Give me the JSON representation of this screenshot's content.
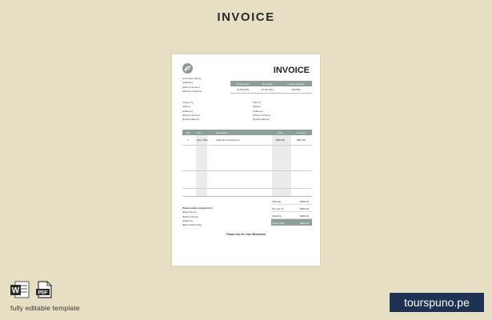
{
  "page_heading": "INVOICE",
  "invoice": {
    "title": "INVOICE",
    "company_lines": [
      "[Company Name]",
      "[Address]",
      "[Phone Number]",
      "[Website Address]"
    ],
    "meta": {
      "headers": [
        "Invoice Date",
        "Due Date",
        "Invoice Number"
      ],
      "values": [
        "31-05-1970",
        "25-04-1971",
        "1437864"
      ]
    },
    "bill_to": {
      "label": "Invoice To:",
      "lines": [
        "[Name]",
        "[Address]",
        "[Phone Number]",
        "[Email Address]"
      ]
    },
    "ship_to": {
      "label": "Ship To:",
      "lines": [
        "[Name]",
        "[Address]",
        "[Phone Number]",
        "[Email Address]"
      ]
    },
    "items": {
      "headers": [
        "Qty",
        "Item",
        "Description",
        "Price",
        "Amount"
      ],
      "rows": [
        {
          "qty": "1",
          "item": "[Item Title]",
          "description": "[Add Item Description]",
          "price": "[$00.00]",
          "amount": "[$00.00]"
        }
      ]
    },
    "totals": [
      {
        "label": "Subtotal",
        "value": "$000.00"
      },
      {
        "label": "Tax rate %",
        "value": "$000.00"
      },
      {
        "label": "Shipping",
        "value": "$000.00"
      },
      {
        "label": "Grand Total",
        "value": "$000.00"
      }
    ],
    "payment": {
      "lead": "Please make a payment to:",
      "lines": [
        "[Bank Name]",
        "[Branch Name]",
        "[Address]",
        "[Bank Swift Code]"
      ]
    },
    "thanks": "Thank You for Your Business!"
  },
  "footer": {
    "word_label": "W",
    "pdf_label": "PDF",
    "editable_text": "fully editable template",
    "brand": "tourspuno.pe"
  },
  "colors": {
    "background": "#e6dfc4",
    "table_header": "#8e9e9a",
    "brand_bg": "#1e3354"
  }
}
